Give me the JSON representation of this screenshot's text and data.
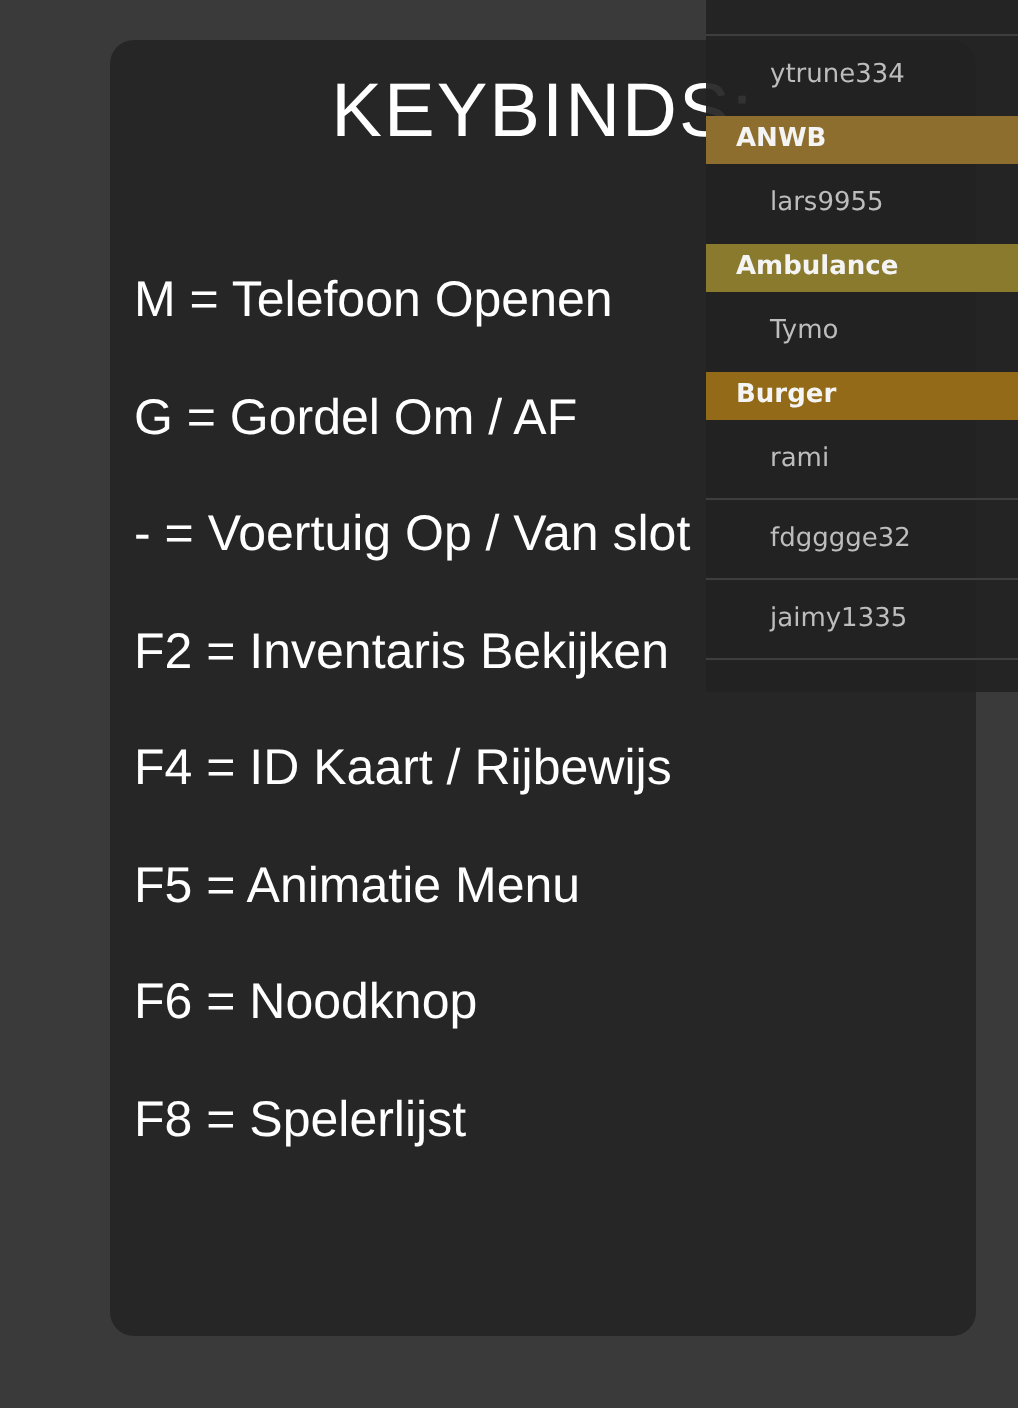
{
  "keybinds": {
    "title": "KEYBINDS:",
    "lines": [
      "M = Telefoon Openen",
      "G = Gordel Om / AF",
      "-  = Voertuig Op / Van slot",
      "F2 = Inventaris Bekijken",
      "F4 = ID Kaart / Rijbewijs",
      "F5 = Animatie Menu",
      "F6 = Noodknop",
      "F8 = Spelerlijst"
    ]
  },
  "player_list": [
    {
      "kind": "player",
      "name": "ytrune334"
    },
    {
      "kind": "header",
      "name": "ANWB",
      "color": "#8d6e2e"
    },
    {
      "kind": "player",
      "name": "lars9955"
    },
    {
      "kind": "header",
      "name": "Ambulance",
      "color": "#8a7a2e"
    },
    {
      "kind": "player",
      "name": "Tymo"
    },
    {
      "kind": "header",
      "name": "Burger",
      "color": "#936a17"
    },
    {
      "kind": "player",
      "name": "rami"
    },
    {
      "kind": "player",
      "name": "fdgggge32"
    },
    {
      "kind": "player",
      "name": "jaimy1335"
    }
  ]
}
